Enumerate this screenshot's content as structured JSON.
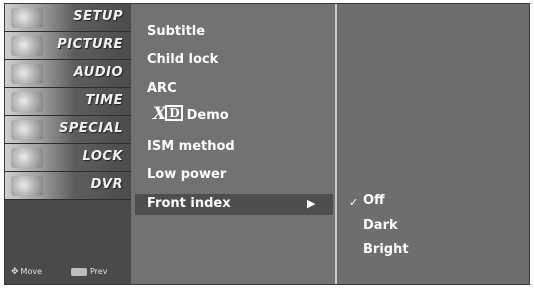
{
  "sidebar": {
    "items": [
      {
        "label": "SETUP",
        "icon": "setup-icon"
      },
      {
        "label": "PICTURE",
        "icon": "picture-icon"
      },
      {
        "label": "AUDIO",
        "icon": "audio-icon"
      },
      {
        "label": "TIME",
        "icon": "time-icon"
      },
      {
        "label": "SPECIAL",
        "icon": "special-icon"
      },
      {
        "label": "LOCK",
        "icon": "lock-icon"
      },
      {
        "label": "DVR",
        "icon": "dvr-icon"
      }
    ],
    "footer": {
      "move_label": "Move",
      "prev_label": "Prev"
    }
  },
  "menu": {
    "items": [
      {
        "label": "Subtitle"
      },
      {
        "label": "Child lock"
      },
      {
        "label": "ARC"
      },
      {
        "label": "Demo",
        "logo": "XD"
      },
      {
        "label": "ISM method"
      },
      {
        "label": "Low power"
      },
      {
        "label": "Front index",
        "selected": true
      }
    ]
  },
  "submenu": {
    "options": [
      {
        "label": "Off",
        "checked": true
      },
      {
        "label": "Dark"
      },
      {
        "label": "Bright"
      }
    ]
  },
  "colors": {
    "background": "#6a6a6a",
    "selected": "#4e4e4e",
    "text": "#ffffff"
  }
}
